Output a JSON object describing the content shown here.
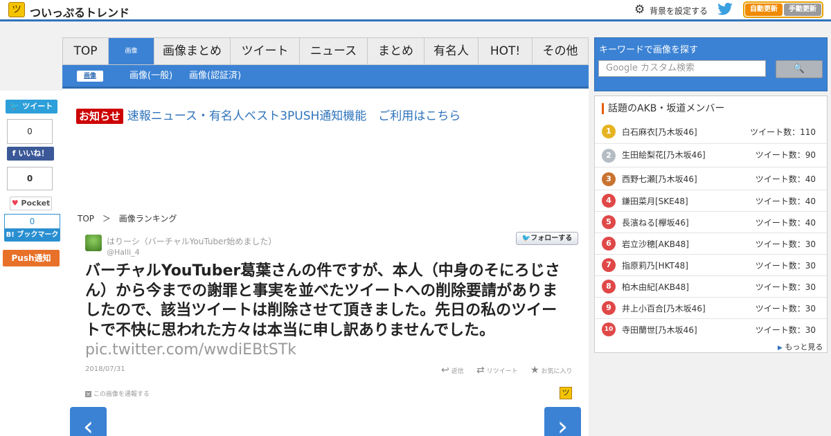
{
  "header": {
    "site_name": "ついっぷるトレンド",
    "logo_icon": "ツ",
    "bg_setting": "背景を設定する",
    "auto_update": "自動更新",
    "manual_update": "手動更新"
  },
  "nav": {
    "tabs": [
      {
        "label": "TOP"
      },
      {
        "label": "画像"
      },
      {
        "label": "画像まとめ"
      },
      {
        "label": "ツイート"
      },
      {
        "label": "ニュース"
      },
      {
        "label": "まとめ"
      },
      {
        "label": "有名人"
      },
      {
        "label": "HOT!"
      },
      {
        "label": "その他"
      }
    ],
    "subtabs": [
      {
        "label": "画像"
      },
      {
        "label": "画像(一般)"
      },
      {
        "label": "画像(認証済)"
      }
    ]
  },
  "share": {
    "tweet": "ツイート",
    "tweet_count": "0",
    "fb_like": "いいね！",
    "pocket_count": "0",
    "pocket": "Pocket",
    "hatena_count": "0",
    "hatena": "B! ブックマーク",
    "push": "Push通知"
  },
  "notice": {
    "badge": "お知らせ",
    "text": "速報ニュース・有名人ベスト3PUSH通知機能　ご利用はこちら"
  },
  "breadcrumb": {
    "home": "TOP",
    "sep": "＞",
    "current": "画像ランキング"
  },
  "tweet": {
    "user": "はりーシ（バーチャルYouTuber始めました）",
    "handle": "@Halli_4",
    "follow": "フォローする",
    "text": "バーチャルYouTuber葛葉さんの件ですが、本人（中身のそにろじさん）から今までの謝罪と事実を並べたツイートへの削除要請がありましたので、該当ツイートは削除させて頂きました。先日の私のツイートで不快に思われた方々は本当に申し訳ありませんでした。",
    "link": "pic.twitter.com/wwdiEBtSTk",
    "date": "2018/07/31",
    "reply": "返信",
    "retweet": "リツイート",
    "favorite": "お気に入り",
    "report": "この画像を通報する",
    "prev": "‹",
    "next": "›"
  },
  "search": {
    "label": "キーワードで画像を探す",
    "placeholder": "Google カスタム検索",
    "button_icon": "search-icon"
  },
  "ranking": {
    "title": "話題のAKB・坂道メンバー",
    "items": [
      {
        "rank": "1",
        "name": "白石麻衣[乃木坂46]",
        "count": "ツイート数：110"
      },
      {
        "rank": "2",
        "name": "生田絵梨花[乃木坂46]",
        "count": "ツイート数：90"
      },
      {
        "rank": "3",
        "name": "西野七瀬[乃木坂46]",
        "count": "ツイート数：40"
      },
      {
        "rank": "4",
        "name": "鎌田菜月[SKE48]",
        "count": "ツイート数：40"
      },
      {
        "rank": "5",
        "name": "長濱ねる[欅坂46]",
        "count": "ツイート数：40"
      },
      {
        "rank": "6",
        "name": "岩立沙穂[AKB48]",
        "count": "ツイート数：30"
      },
      {
        "rank": "7",
        "name": "指原莉乃[HKT48]",
        "count": "ツイート数：30"
      },
      {
        "rank": "8",
        "name": "柏木由紀[AKB48]",
        "count": "ツイート数：30"
      },
      {
        "rank": "9",
        "name": "井上小百合[乃木坂46]",
        "count": "ツイート数：30"
      },
      {
        "rank": "10",
        "name": "寺田蘭世[乃木坂46]",
        "count": "ツイート数：30"
      }
    ],
    "more": "もっと見る"
  },
  "colors": {
    "accent": "#3b82d4",
    "notice_red": "#cc0000",
    "gold": "#e6b422",
    "silver": "#b5bcc4",
    "bronze": "#c8732f",
    "rank_red": "#e04848",
    "push_orange": "#e8712a"
  }
}
